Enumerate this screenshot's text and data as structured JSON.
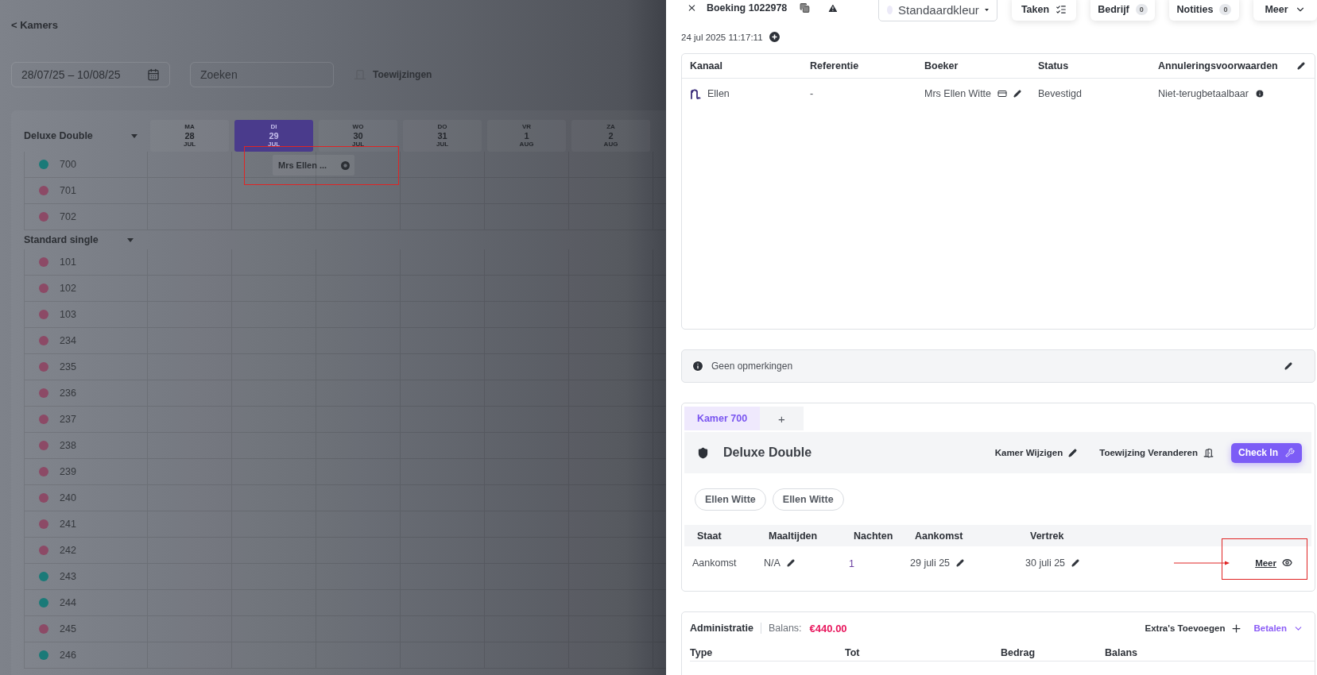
{
  "back_link": "< Kamers",
  "filters": {
    "date_range": "28/07/25 – 10/08/25",
    "search": {
      "placeholder": "Zoeken"
    },
    "assignments_button": "Toewijzingen"
  },
  "calendar": {
    "days": [
      {
        "weekday": "MA",
        "day": "28",
        "month": "JUL",
        "selected": false
      },
      {
        "weekday": "DI",
        "day": "29",
        "month": "JUL",
        "selected": true
      },
      {
        "weekday": "WO",
        "day": "30",
        "month": "JUL",
        "selected": false
      },
      {
        "weekday": "DO",
        "day": "31",
        "month": "JUL",
        "selected": false
      },
      {
        "weekday": "VR",
        "day": "1",
        "month": "AUG",
        "selected": false
      },
      {
        "weekday": "ZA",
        "day": "2",
        "month": "AUG",
        "selected": false
      }
    ],
    "room_groups": [
      {
        "name": "Deluxe Double",
        "rooms": [
          {
            "number": "700",
            "color": "#1a7a78",
            "booking": {
              "label": "Mrs Ellen ..."
            }
          },
          {
            "number": "701",
            "color": "#8c4a66"
          },
          {
            "number": "702",
            "color": "#8c4a66"
          }
        ]
      },
      {
        "name": "Standard single",
        "rooms": [
          {
            "number": "101",
            "color": "#8c4a66"
          },
          {
            "number": "102",
            "color": "#8c4a66"
          },
          {
            "number": "103",
            "color": "#8c4a66"
          },
          {
            "number": "234",
            "color": "#8c4a66"
          },
          {
            "number": "235",
            "color": "#8c4a66"
          },
          {
            "number": "236",
            "color": "#8c4a66"
          },
          {
            "number": "237",
            "color": "#8c4a66"
          },
          {
            "number": "238",
            "color": "#8c4a66"
          },
          {
            "number": "239",
            "color": "#8c4a66"
          },
          {
            "number": "240",
            "color": "#8c4a66"
          },
          {
            "number": "241",
            "color": "#8c4a66"
          },
          {
            "number": "242",
            "color": "#8c4a66"
          },
          {
            "number": "243",
            "color": "#1a7a78"
          },
          {
            "number": "244",
            "color": "#1a7a78"
          },
          {
            "number": "245",
            "color": "#8c4a66"
          },
          {
            "number": "246",
            "color": "#1a7a78"
          }
        ]
      }
    ]
  },
  "booking_panel": {
    "title": "Boeking 1022978",
    "color_select": "Standaardkleur",
    "actions": [
      {
        "label": "Taken",
        "kind": "list"
      },
      {
        "label": "Bedrijf",
        "kind": "count",
        "count": "0"
      },
      {
        "label": "Notities",
        "kind": "count",
        "count": "0"
      },
      {
        "label": "Meer",
        "kind": "menu"
      }
    ],
    "created": "24 jul 2025 11:17:11",
    "details": {
      "columns": [
        "Kanaal",
        "Referentie",
        "Boeker",
        "Status",
        "Annuleringsvoorwaarden"
      ],
      "rows": [
        [
          {
            "text": "Ellen",
            "kind": "channel"
          },
          {
            "text": "-",
            "kind": "plain"
          },
          {
            "text": "Mrs Ellen Witte",
            "kind": "booker"
          },
          {
            "text": "Bevestigd",
            "kind": "plain"
          },
          {
            "text": "Niet-terugbetaalbaar",
            "kind": "info"
          }
        ]
      ]
    },
    "remarks": "Geen opmerkingen",
    "room_tabs": [
      {
        "label": "Kamer 700",
        "selected": true
      },
      {
        "label": "+",
        "selected": false
      }
    ],
    "room": {
      "type": "Deluxe Double",
      "change_room": "Kamer Wijzigen",
      "change_assignment": "Toewijzing Veranderen",
      "check_in": "Check In",
      "guests": [
        "Ellen Witte",
        "Ellen Witte"
      ],
      "stay_columns": [
        "Staat",
        "Maaltijden",
        "Nachten",
        "Aankomst",
        "Vertrek"
      ],
      "stay_row": [
        {
          "text": "Aankomst",
          "kind": "plain"
        },
        {
          "text": "N/A",
          "kind": "editable"
        },
        {
          "text": "1",
          "kind": "link"
        },
        {
          "text": "29 juli 25",
          "kind": "editable"
        },
        {
          "text": "30 juli 25",
          "kind": "editable"
        }
      ],
      "more": "Meer"
    },
    "administration": {
      "title": "Administratie",
      "balance_label": "Balans:",
      "balance": "€440.00",
      "add_extras": "Extra's Toevoegen",
      "pay": "Betalen",
      "columns": [
        "Type",
        "Tot",
        "Bedrag",
        "Balans"
      ]
    }
  }
}
